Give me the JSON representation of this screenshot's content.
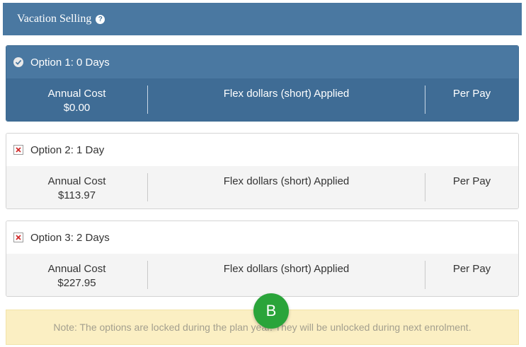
{
  "header": {
    "title": "Vacation Selling",
    "help_icon": "?"
  },
  "options": [
    {
      "title": "Option 1: 0 Days",
      "status": "selected",
      "annual_label": "Annual Cost",
      "annual_value": "$0.00",
      "flex_label": "Flex dollars (short) Applied",
      "perpay_label": "Per Pay"
    },
    {
      "title": "Option 2: 1 Day",
      "status": "unselected",
      "annual_label": "Annual Cost",
      "annual_value": "$113.97",
      "flex_label": "Flex dollars (short) Applied",
      "perpay_label": "Per Pay"
    },
    {
      "title": "Option 3: 2 Days",
      "status": "unselected",
      "annual_label": "Annual Cost",
      "annual_value": "$227.95",
      "flex_label": "Flex dollars (short) Applied",
      "perpay_label": "Per Pay"
    }
  ],
  "note": "Note: The options are locked during the plan year. They will be unlocked during next enrolment.",
  "marker": {
    "label": "B"
  },
  "colors": {
    "header": "#4a78a1",
    "selected_body": "#3f6c95",
    "note_bg": "#fbefc3",
    "marker": "#2aa43a"
  },
  "icons": {
    "selected": "check-icon",
    "unselected": "x-icon",
    "help": "help-icon"
  }
}
